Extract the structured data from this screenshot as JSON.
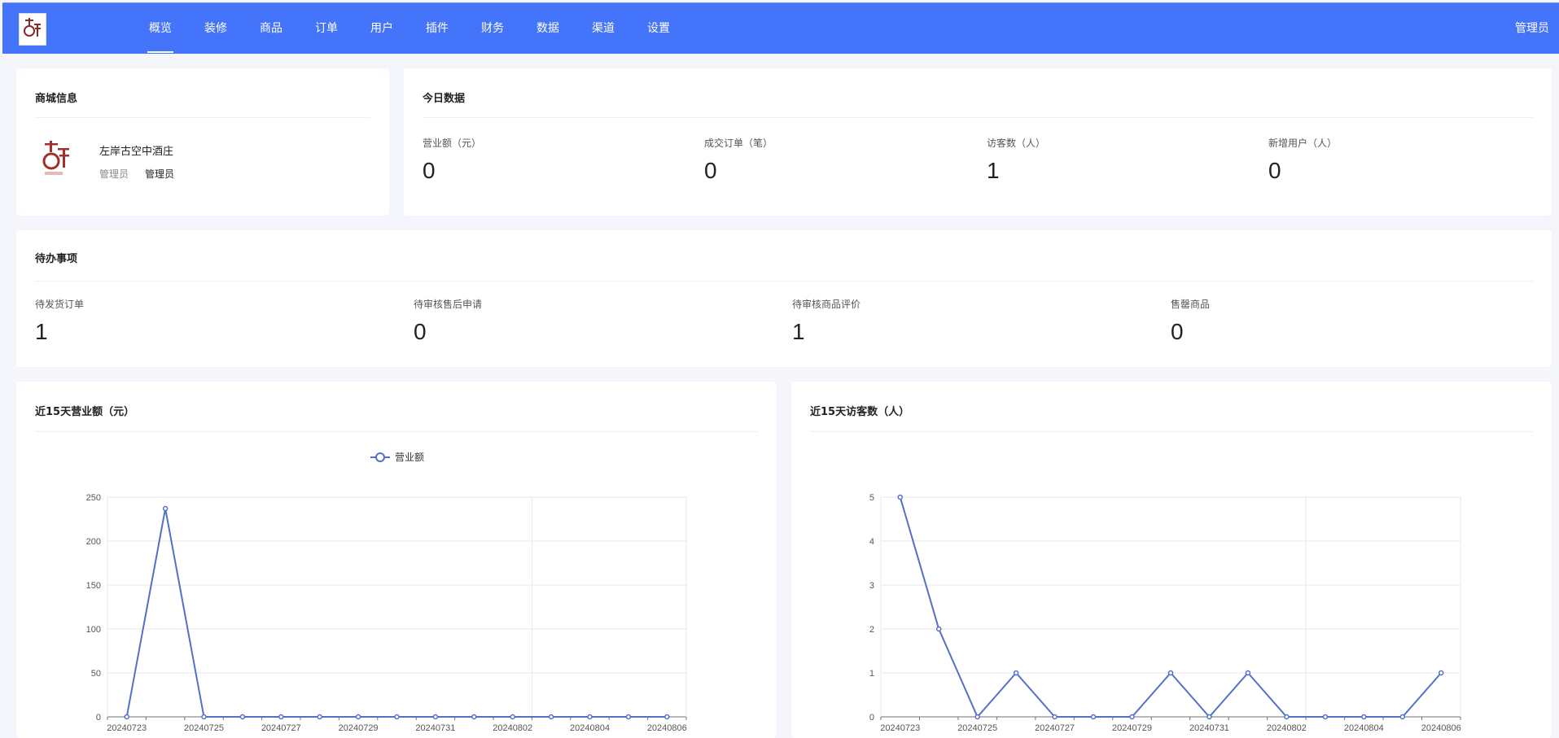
{
  "header": {
    "nav": [
      {
        "label": "概览",
        "active": true
      },
      {
        "label": "装修"
      },
      {
        "label": "商品"
      },
      {
        "label": "订单"
      },
      {
        "label": "用户"
      },
      {
        "label": "插件"
      },
      {
        "label": "财务"
      },
      {
        "label": "数据"
      },
      {
        "label": "渠道"
      },
      {
        "label": "设置"
      }
    ],
    "user": "管理员"
  },
  "shop_info": {
    "title": "商城信息",
    "name": "左岸古空中酒庄",
    "role_label": "管理员",
    "role_value": "管理员"
  },
  "today": {
    "title": "今日数据",
    "stats": [
      {
        "label": "营业额（元）",
        "value": "0"
      },
      {
        "label": "成交订单（笔）",
        "value": "0"
      },
      {
        "label": "访客数（人）",
        "value": "1"
      },
      {
        "label": "新增用户（人）",
        "value": "0"
      }
    ]
  },
  "todo": {
    "title": "待办事项",
    "stats": [
      {
        "label": "待发货订单",
        "value": "1"
      },
      {
        "label": "待审核售后申请",
        "value": "0"
      },
      {
        "label": "待审核商品评价",
        "value": "1"
      },
      {
        "label": "售罄商品",
        "value": "0"
      }
    ]
  },
  "revenue_card": {
    "title": "近15天营业额（元）"
  },
  "visitor_card": {
    "title": "近15天访客数（人）"
  },
  "chart_data": [
    {
      "type": "line",
      "title": "近15天营业额（元）",
      "x": [
        "20240723",
        "20240724",
        "20240725",
        "20240726",
        "20240727",
        "20240728",
        "20240729",
        "20240730",
        "20240731",
        "20240801",
        "20240802",
        "20240803",
        "20240804",
        "20240805",
        "20240806"
      ],
      "x_tick_labels": [
        "20240723",
        "20240725",
        "20240727",
        "20240729",
        "20240731",
        "20240802",
        "20240804",
        "20240806"
      ],
      "series": [
        {
          "name": "营业额",
          "values": [
            0,
            237,
            0,
            0,
            0,
            0,
            0,
            0,
            0,
            0,
            0,
            0,
            0,
            0,
            0
          ],
          "color": "#5470c6"
        }
      ],
      "ylim": [
        0,
        250
      ],
      "yticks": [
        0,
        50,
        100,
        150,
        200,
        250
      ],
      "legend": "top-center",
      "grid": true
    },
    {
      "type": "line",
      "title": "近15天访客数（人）",
      "x": [
        "20240723",
        "20240724",
        "20240725",
        "20240726",
        "20240727",
        "20240728",
        "20240729",
        "20240730",
        "20240731",
        "20240801",
        "20240802",
        "20240803",
        "20240804",
        "20240805",
        "20240806"
      ],
      "x_tick_labels": [
        "20240723",
        "20240725",
        "20240727",
        "20240729",
        "20240731",
        "20240802",
        "20240804",
        "20240806"
      ],
      "series": [
        {
          "values": [
            5,
            2,
            0,
            1,
            0,
            0,
            0,
            1,
            0,
            1,
            0,
            0,
            0,
            0,
            1
          ],
          "color": "#5470c6"
        }
      ],
      "ylim": [
        0,
        5
      ],
      "yticks": [
        0,
        1,
        2,
        3,
        4,
        5
      ],
      "grid": true
    }
  ],
  "icons": {
    "logo": "shop-logo-icon",
    "legend": "circle-line-legend-icon"
  }
}
